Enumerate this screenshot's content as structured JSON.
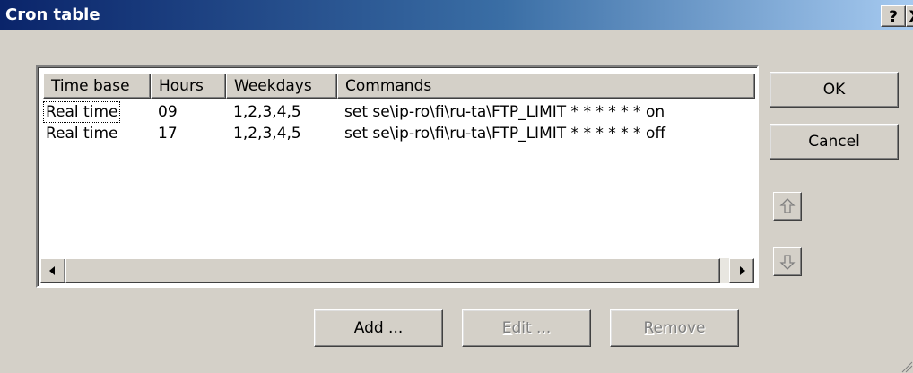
{
  "window": {
    "title": "Cron table",
    "help_label": "?",
    "close_label": "X"
  },
  "table": {
    "columns": [
      "Time base",
      "Hours",
      "Weekdays",
      "Commands"
    ],
    "rows": [
      {
        "time_base": "Real time",
        "hours": "09",
        "weekdays": "1,2,3,4,5",
        "command": "set se\\ip-ro\\fi\\ru-ta\\FTP_LIMIT * * * * * * on"
      },
      {
        "time_base": "Real time",
        "hours": "17",
        "weekdays": "1,2,3,4,5",
        "command": "set se\\ip-ro\\fi\\ru-ta\\FTP_LIMIT * * * * * * off"
      }
    ]
  },
  "buttons": {
    "ok": "OK",
    "cancel": "Cancel",
    "add_prefix": "",
    "add_accel": "A",
    "add_rest": "dd ...",
    "edit_prefix": "",
    "edit_accel": "E",
    "edit_rest": "dit ...",
    "remove_prefix": "",
    "remove_accel": "R",
    "remove_rest": "emove"
  },
  "icons": {
    "move_up": "up-arrow-icon",
    "move_down": "down-arrow-icon",
    "scroll_left": "left-triangle-icon",
    "scroll_right": "right-triangle-icon"
  }
}
